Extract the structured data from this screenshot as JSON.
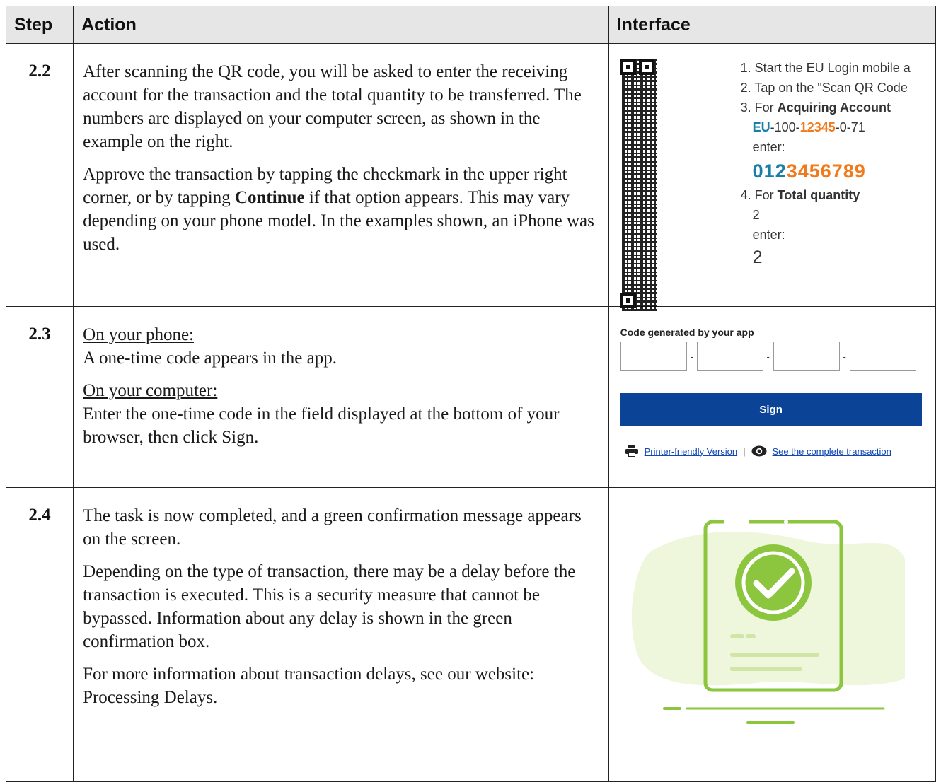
{
  "header": {
    "step": "Step",
    "action": "Action",
    "interface": "Interface"
  },
  "rows": [
    {
      "step": "2.2",
      "p1": "After scanning the QR code, you will be asked to enter the receiving account for the transaction and the total quantity to be transferred. The numbers are displayed on your computer screen, as shown in the example on the right.",
      "p2_before": "Approve the transaction by tapping the checkmark in the upper right corner, or by tapping ",
      "p2_bold": "Continue",
      "p2_after": " if that option appears. This may vary depending on your phone model. In the examples shown, an iPhone was used."
    },
    {
      "step": "2.3",
      "phone_label": "On your phone:",
      "phone_text": "A one-time code appears in the app.",
      "computer_label": "On your computer:",
      "computer_text": "Enter the one-time code in the field displayed at the bottom of your browser, then click Sign."
    },
    {
      "step": "2.4",
      "p1": "The task is now completed, and a green confirmation message appears on the screen.",
      "p2": "Depending on the type of transaction, there may be a delay before the transaction is executed. This is a security measure that cannot be bypassed. Information about any delay is shown in the green confirmation box.",
      "p3": "For more information about transaction delays, see our website: Processing Delays."
    }
  ],
  "qr_panel": {
    "line1": "1. Start the EU Login mobile a",
    "line2": "2. Tap on the \"Scan QR Code",
    "line3_prefix": "3. For ",
    "line3_bold": "Acquiring Account",
    "acct_eu": "EU",
    "acct_mid1": "-100-",
    "acct_orange": "12345",
    "acct_tail": "-0-71",
    "enter1": "enter:",
    "code_blue": "012",
    "code_orange": "3456789",
    "line4_prefix": "4. For ",
    "line4_bold": "Total quantity",
    "qty": "2",
    "enter2": "enter:",
    "qty_big": "2"
  },
  "sign_panel": {
    "label": "Code generated by your app",
    "dash": "-",
    "button": "Sign",
    "link1": "Printer-friendly Version",
    "sep": "|",
    "link2": "See the complete transaction"
  },
  "colors": {
    "brand_blue": "#0b4496",
    "account_blue": "#1a7fa8",
    "accent_orange": "#f07b1e",
    "success_green": "#8cc63f"
  }
}
